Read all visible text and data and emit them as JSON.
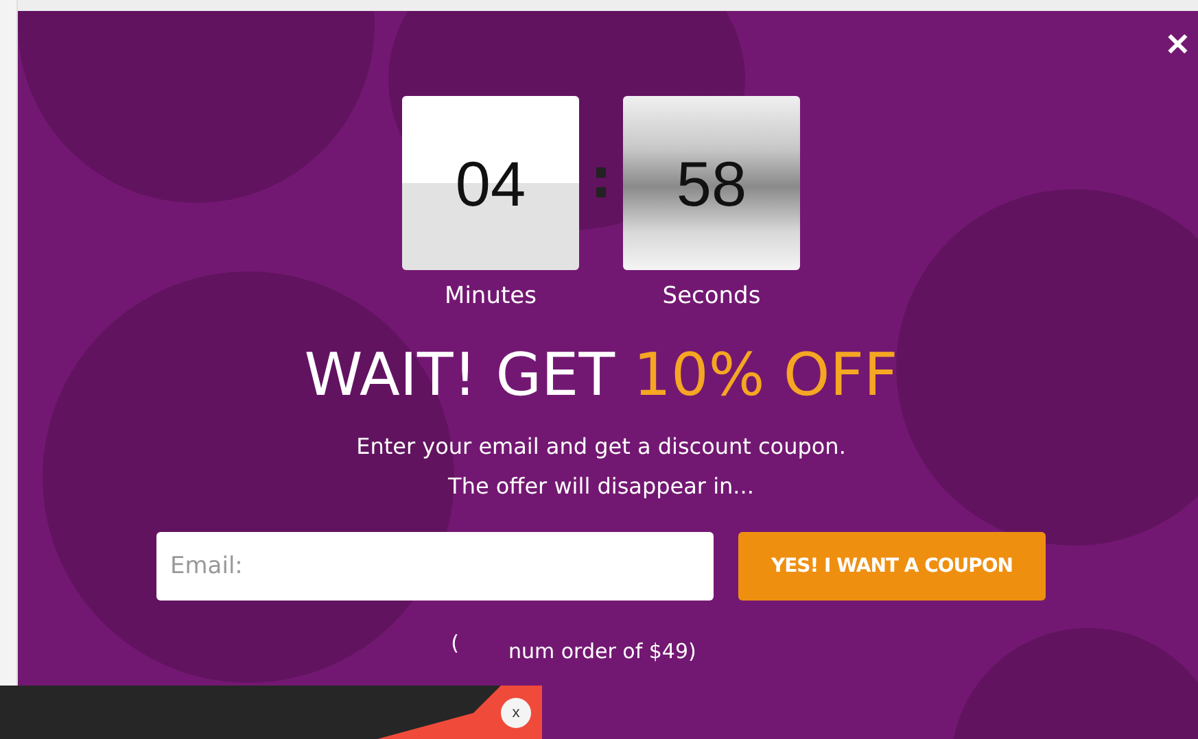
{
  "popup": {
    "close": "✕",
    "timer": [
      {
        "value": "04",
        "label": "Minutes",
        "kind": "flat"
      },
      {
        "value": "58",
        "label": "Seconds",
        "kind": "chrome"
      }
    ],
    "separator": ":",
    "headline": "WAIT! GET",
    "highlight": "10% OFF",
    "message": [
      "Enter your email and get a discount coupon.",
      "The offer will disappear in..."
    ],
    "email": {
      "placeholder": "Email:"
    },
    "button": "YES! I WANT A COUPON",
    "note": [
      "(",
      "num order of $49)"
    ]
  },
  "overlay_widget": {
    "close": "x"
  }
}
